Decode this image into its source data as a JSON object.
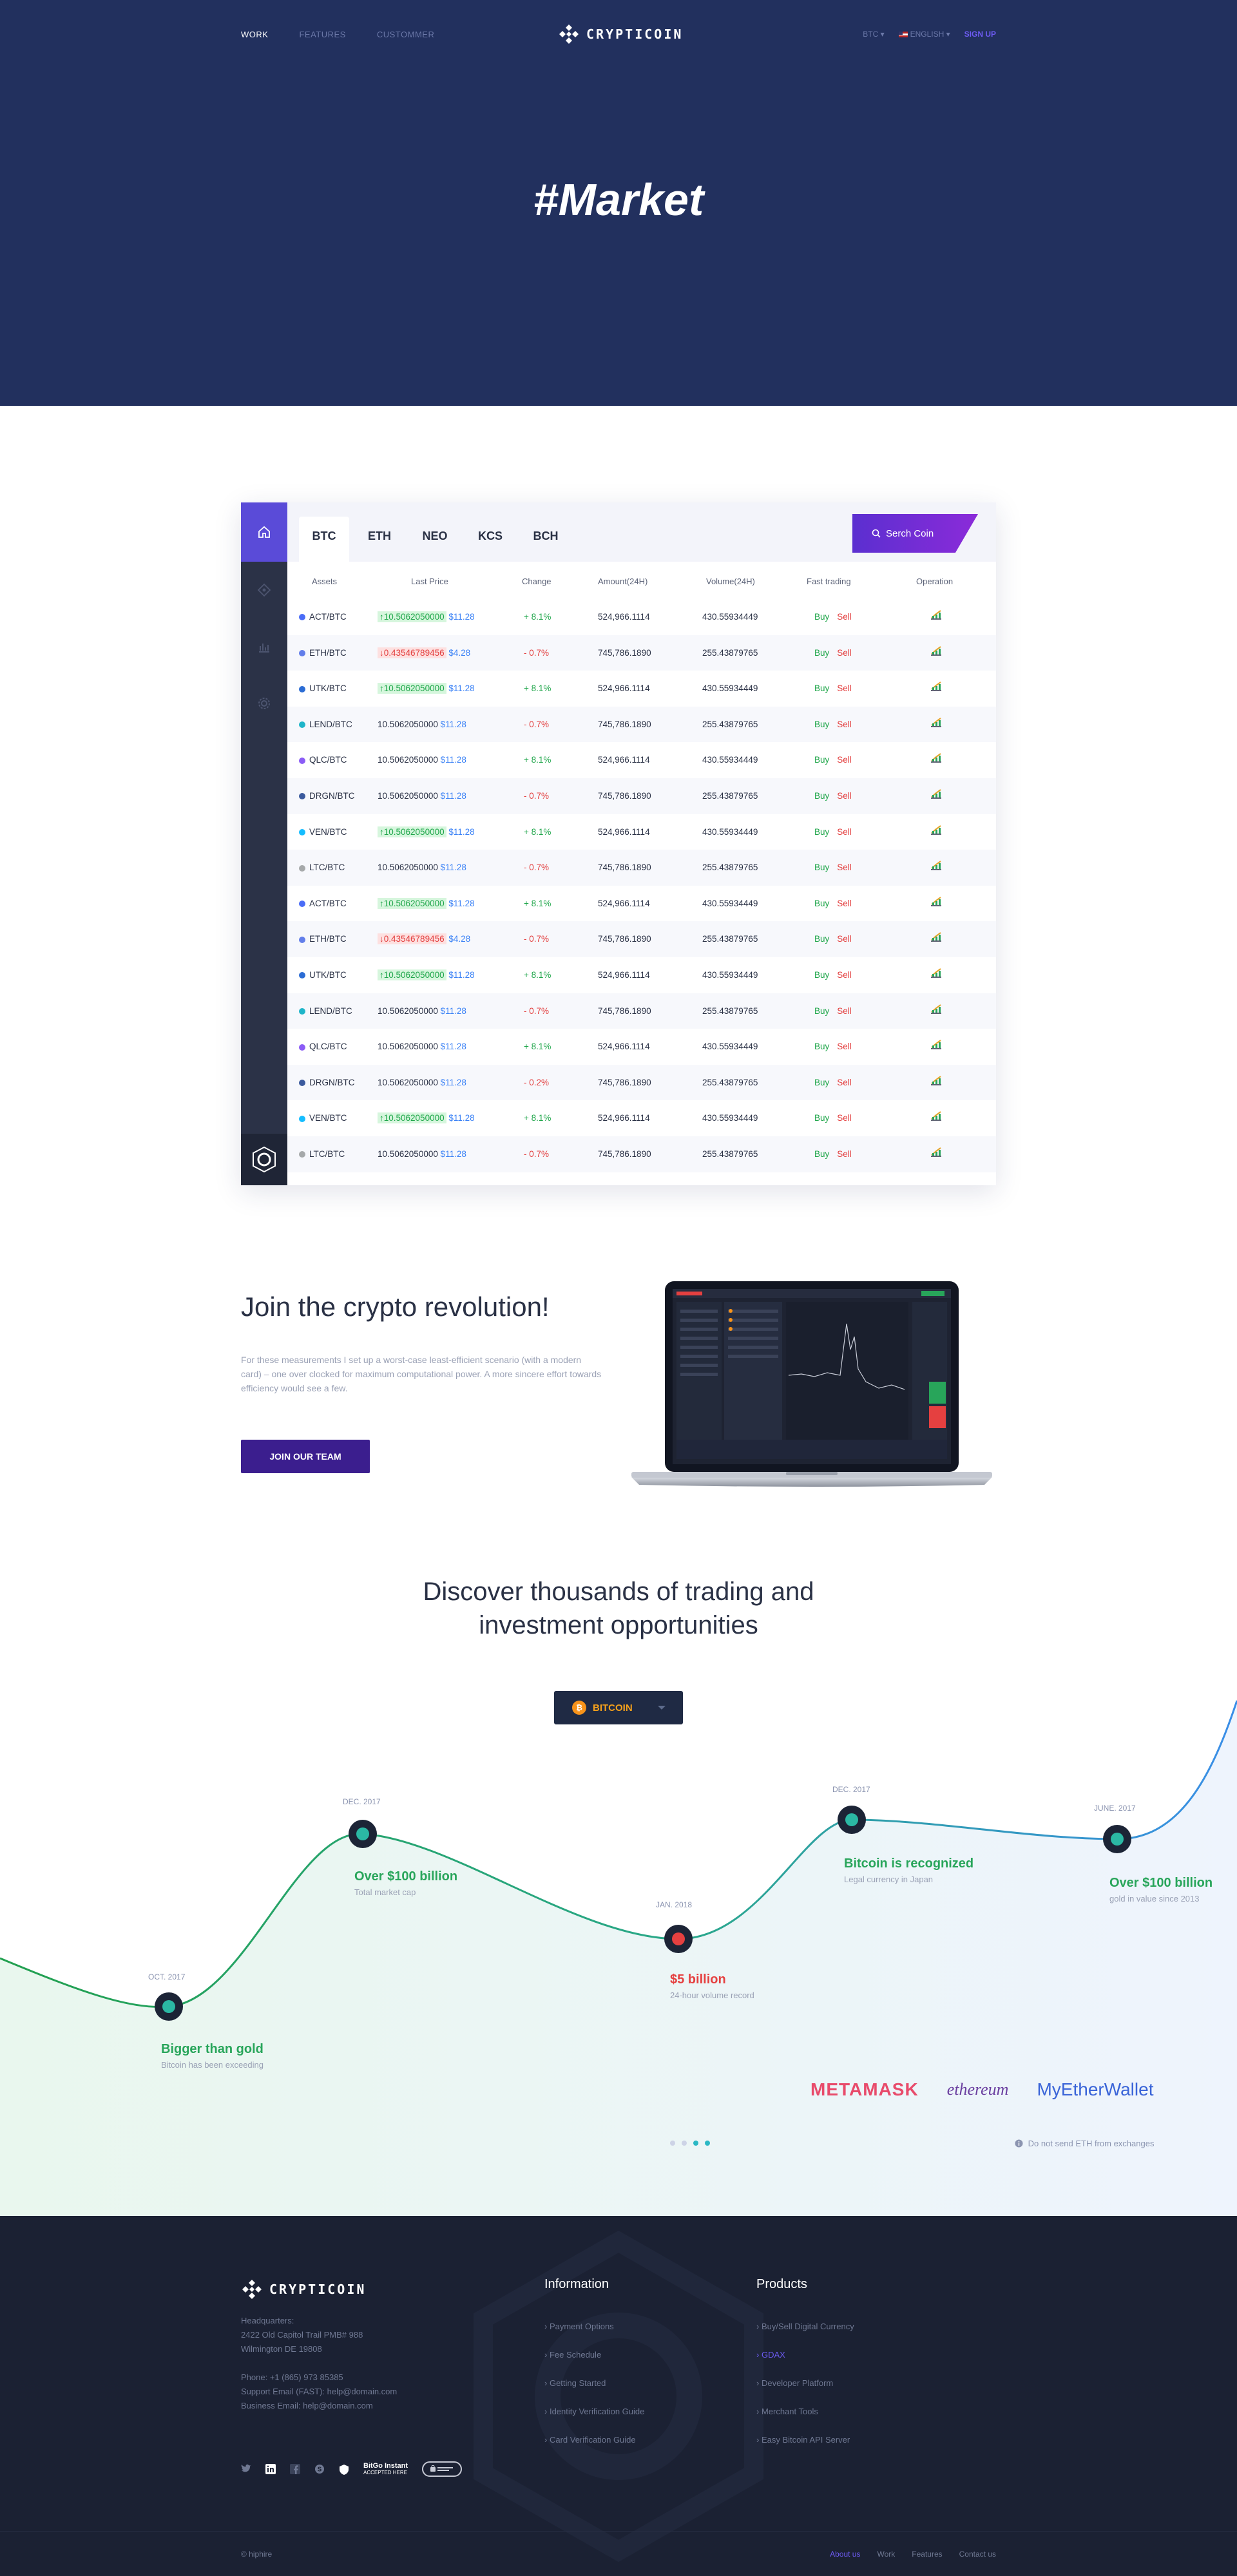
{
  "nav": {
    "links": [
      "WORK",
      "FEATURES",
      "CUSTOMMER"
    ],
    "brand": "CRYPTICOIN",
    "currency": "BTC ▾",
    "language": "ENGLISH ▾",
    "signup": "SIGN UP"
  },
  "hero": {
    "title": "#Market"
  },
  "market": {
    "tabs": [
      "BTC",
      "ETH",
      "NEO",
      "KCS",
      "BCH"
    ],
    "search_label": "Serch Coin",
    "columns": [
      "Assets",
      "Last Price",
      "Change",
      "Amount(24H)",
      "Volume(24H)",
      "Fast trading",
      "Operation"
    ],
    "buy_label": "Buy",
    "sell_label": "Sell",
    "rows": [
      {
        "asset": "ACT/BTC",
        "last": "↑10.5062050000",
        "dir": "up",
        "price": "$11.28",
        "change": "+ 8.1%",
        "amount": "524,966.1114",
        "volume": "430.55934449",
        "color": "#4a6cf7"
      },
      {
        "asset": "ETH/BTC",
        "last": "↓0.43546789456",
        "dir": "down",
        "price": "$4.28",
        "change": "- 0.7%",
        "amount": "745,786.1890",
        "volume": "255.43879765",
        "color": "#627eea"
      },
      {
        "asset": "UTK/BTC",
        "last": "↑10.5062050000",
        "dir": "up",
        "price": "$11.28",
        "change": "+ 8.1%",
        "amount": "524,966.1114",
        "volume": "430.55934449",
        "color": "#2b6cd4"
      },
      {
        "asset": "LEND/BTC",
        "last": "10.5062050000",
        "dir": "none",
        "price": "$11.28",
        "change": "- 0.7%",
        "amount": "745,786.1890",
        "volume": "255.43879765",
        "color": "#1fb5c9"
      },
      {
        "asset": "QLC/BTC",
        "last": "10.5062050000",
        "dir": "none",
        "price": "$11.28",
        "change": "+ 8.1%",
        "amount": "524,966.1114",
        "volume": "430.55934449",
        "color": "#8b5cf6"
      },
      {
        "asset": "DRGN/BTC",
        "last": "10.5062050000",
        "dir": "none",
        "price": "$11.28",
        "change": "- 0.7%",
        "amount": "745,786.1890",
        "volume": "255.43879765",
        "color": "#3b5a9d"
      },
      {
        "asset": "VEN/BTC",
        "last": "↑10.5062050000",
        "dir": "up",
        "price": "$11.28",
        "change": "+ 8.1%",
        "amount": "524,966.1114",
        "volume": "430.55934449",
        "color": "#15bdff"
      },
      {
        "asset": "LTC/BTC",
        "last": "10.5062050000",
        "dir": "none",
        "price": "$11.28",
        "change": "- 0.7%",
        "amount": "745,786.1890",
        "volume": "255.43879765",
        "color": "#a6a9aa"
      },
      {
        "asset": "ACT/BTC",
        "last": "↑10.5062050000",
        "dir": "up",
        "price": "$11.28",
        "change": "+ 8.1%",
        "amount": "524,966.1114",
        "volume": "430.55934449",
        "color": "#4a6cf7"
      },
      {
        "asset": "ETH/BTC",
        "last": "↓0.43546789456",
        "dir": "down",
        "price": "$4.28",
        "change": "- 0.7%",
        "amount": "745,786.1890",
        "volume": "255.43879765",
        "color": "#627eea"
      },
      {
        "asset": "UTK/BTC",
        "last": "↑10.5062050000",
        "dir": "up",
        "price": "$11.28",
        "change": "+ 8.1%",
        "amount": "524,966.1114",
        "volume": "430.55934449",
        "color": "#2b6cd4"
      },
      {
        "asset": "LEND/BTC",
        "last": "10.5062050000",
        "dir": "none",
        "price": "$11.28",
        "change": "- 0.7%",
        "amount": "745,786.1890",
        "volume": "255.43879765",
        "color": "#1fb5c9"
      },
      {
        "asset": "QLC/BTC",
        "last": "10.5062050000",
        "dir": "none",
        "price": "$11.28",
        "change": "+ 8.1%",
        "amount": "524,966.1114",
        "volume": "430.55934449",
        "color": "#8b5cf6"
      },
      {
        "asset": "DRGN/BTC",
        "last": "10.5062050000",
        "dir": "none",
        "price": "$11.28",
        "change": "- 0.2%",
        "amount": "745,786.1890",
        "volume": "255.43879765",
        "color": "#3b5a9d"
      },
      {
        "asset": "VEN/BTC",
        "last": "↑10.5062050000",
        "dir": "up",
        "price": "$11.28",
        "change": "+ 8.1%",
        "amount": "524,966.1114",
        "volume": "430.55934449",
        "color": "#15bdff"
      },
      {
        "asset": "LTC/BTC",
        "last": "10.5062050000",
        "dir": "none",
        "price": "$11.28",
        "change": "- 0.7%",
        "amount": "745,786.1890",
        "volume": "255.43879765",
        "color": "#a6a9aa"
      }
    ]
  },
  "join": {
    "title": "Join the crypto revolution!",
    "text": "For these measurements I set up a worst-case least-efficient scenario (with a modern card) – one over clocked for maximum computational power. A more sincere effort towards efficiency would see a few.",
    "button": "JOIN OUR TEAM"
  },
  "discover": {
    "title_line1": "Discover thousands of trading and",
    "title_line2": "investment opportunities",
    "select": "BITCOIN"
  },
  "timeline": [
    {
      "date": "OCT. 2017",
      "title": "Bigger than gold",
      "sub": "Bitcoin has been exceeding",
      "tone": "green"
    },
    {
      "date": "DEC. 2017",
      "title": "Over $100 billion",
      "sub": "Total market cap",
      "tone": "green"
    },
    {
      "date": "JAN. 2018",
      "title": "$5 billion",
      "sub": "24-hour volume record",
      "tone": "red"
    },
    {
      "date": "DEC. 2017",
      "title": "Bitcoin is recognized",
      "sub": "Legal currency in Japan",
      "tone": "green"
    },
    {
      "date": "JUNE. 2017",
      "title": "Over $100 billion",
      "sub": "gold in value since 2013",
      "tone": "green"
    }
  ],
  "partners": {
    "metamask": "METAMASK",
    "ethereum": "ethereum",
    "mew": "MyEtherWallet"
  },
  "warning": "Do not send ETH from exchanges",
  "footer": {
    "brand": "CRYPTICOIN",
    "address": [
      "Headquarters:",
      "2422 Old Capitol Trail PMB# 988",
      "Wilmington DE 19808",
      "",
      "Phone: +1 (865) 973 85385",
      "Support Email (FAST): help@domain.com",
      "Business Email: help@domain.com"
    ],
    "info_title": "Information",
    "info_links": [
      "Payment Options",
      "Fee Schedule",
      "Getting Started",
      "Identity Verification Guide",
      "Card Verification Guide"
    ],
    "prod_title": "Products",
    "prod_links": [
      "Buy/Sell Digital Currency",
      "GDAX",
      "Developer Platform",
      "Merchant Tools",
      "Easy Bitcoin API Server"
    ],
    "badge_line1": "BitGo Instant",
    "badge_line2": "ACCEPTED HERE",
    "copyright": "© hiphire",
    "bottom_links": [
      "About us",
      "Work",
      "Features",
      "Contact us"
    ]
  }
}
